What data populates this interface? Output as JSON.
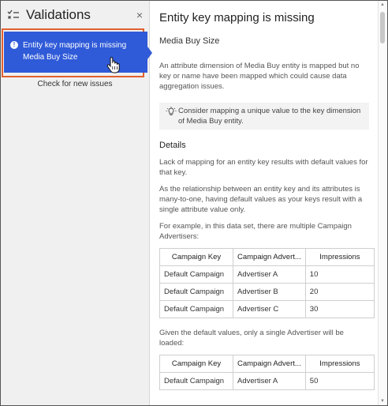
{
  "left_panel": {
    "title": "Validations",
    "close_symbol": "×",
    "issue": {
      "title": "Entity key mapping is missing",
      "subtitle": "Media Buy Size",
      "alert_symbol": "!"
    },
    "check_link": "Check for new issues"
  },
  "right_panel": {
    "title": "Entity key mapping is missing",
    "subtitle": "Media Buy Size",
    "description": "An attribute dimension of Media Buy entity is mapped but no key or name have been mapped which could cause data aggregation issues.",
    "tip": "Consider mapping a unique value to the key dimension of Media Buy entity.",
    "details_heading": "Details",
    "paragraph1": "Lack of mapping for an entity key results with default values for that key.",
    "paragraph2": "As the relationship between an entity key and its attributes is many-to-one, having default values as your keys result with a single attribute value only.",
    "paragraph3": "For example, in this data set, there are multiple Campaign Advertisers:",
    "table1": {
      "headers": [
        "Campaign Key",
        "Campaign Advert...",
        "Impressions"
      ],
      "rows": [
        [
          "Default Campaign",
          "Advertiser A",
          "10"
        ],
        [
          "Default Campaign",
          "Advertiser B",
          "20"
        ],
        [
          "Default Campaign",
          "Advertiser C",
          "30"
        ]
      ]
    },
    "paragraph4": "Given the default values, only a single Advertiser will be loaded:",
    "table2": {
      "headers": [
        "Campaign Key",
        "Campaign Advert...",
        "Impressions"
      ],
      "rows": [
        [
          "Default Campaign",
          "Advertiser A",
          "50"
        ]
      ]
    }
  },
  "colors": {
    "accent": "#2f5ad8",
    "highlight_outline": "#e06030"
  },
  "icons": [
    "list-check-icon",
    "close-icon",
    "alert-icon",
    "hand-cursor-icon",
    "lightbulb-icon"
  ]
}
